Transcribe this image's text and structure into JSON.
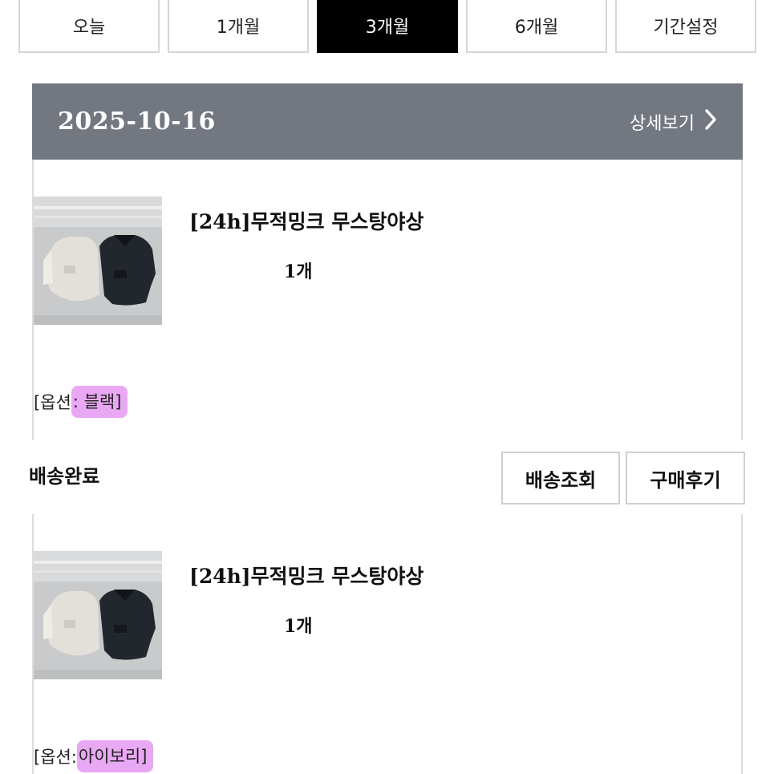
{
  "period_tabs": [
    {
      "label": "오늘",
      "active": false
    },
    {
      "label": "1개월",
      "active": false
    },
    {
      "label": "3개월",
      "active": true
    },
    {
      "label": "6개월",
      "active": false
    },
    {
      "label": "기간설정",
      "active": false
    }
  ],
  "order": {
    "date": "2025-10-16",
    "detail_label": "상세보기",
    "status": "배송완료",
    "actions": {
      "track_label": "배송조회",
      "review_label": "구매후기"
    },
    "items": [
      {
        "name": "[24h]무적밍크 무스탕야상",
        "quantity": "1개",
        "option_prefix": "[옵션",
        "option_value": ": 블랙]",
        "image_icon": "jacket-product-photo"
      },
      {
        "name": "[24h]무적밍크 무스탕야상",
        "quantity": "1개",
        "option_prefix": "[옵션: ",
        "option_value": "아이보리]",
        "image_icon": "jacket-product-photo"
      }
    ]
  },
  "colors": {
    "active_tab": "#000000",
    "header_bg": "#727780",
    "highlight": "#e9a8f3"
  }
}
